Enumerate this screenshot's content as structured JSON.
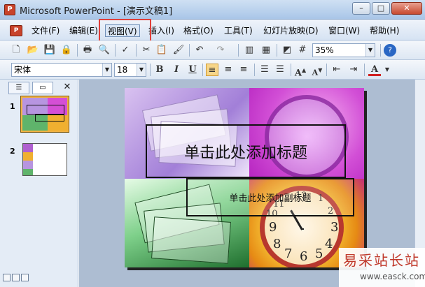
{
  "window": {
    "title": "Microsoft PowerPoint - [演示文稿1]",
    "app_icon": "powerpoint-icon",
    "buttons": [
      "minimize",
      "maximize",
      "close"
    ]
  },
  "menubar": {
    "items": [
      "文件(F)",
      "编辑(E)",
      "视图(V)",
      "插入(I)",
      "格式(O)",
      "工具(T)",
      "幻灯片放映(D)",
      "窗口(W)",
      "帮助(H)"
    ],
    "selected": "视图(V)",
    "highlight_color": "#e0403a"
  },
  "toolbar_standard": {
    "zoom": "35%"
  },
  "toolbar_format": {
    "font_name": "宋体",
    "font_size": "18",
    "bold": "B",
    "italic": "I",
    "underline": "U"
  },
  "left_panel": {
    "slides": [
      "1",
      "2"
    ],
    "selected_slide": "1"
  },
  "slide": {
    "title_placeholder": "单击此处添加标题",
    "subtitle_placeholder": "单击此处添加副标题",
    "clock_numbers": [
      "9",
      "3",
      "6",
      "11",
      "12",
      "1",
      "10",
      "2",
      "8",
      "4",
      "7",
      "5"
    ]
  },
  "watermark": {
    "text": "易采站长站",
    "url": "www.easck.com"
  }
}
